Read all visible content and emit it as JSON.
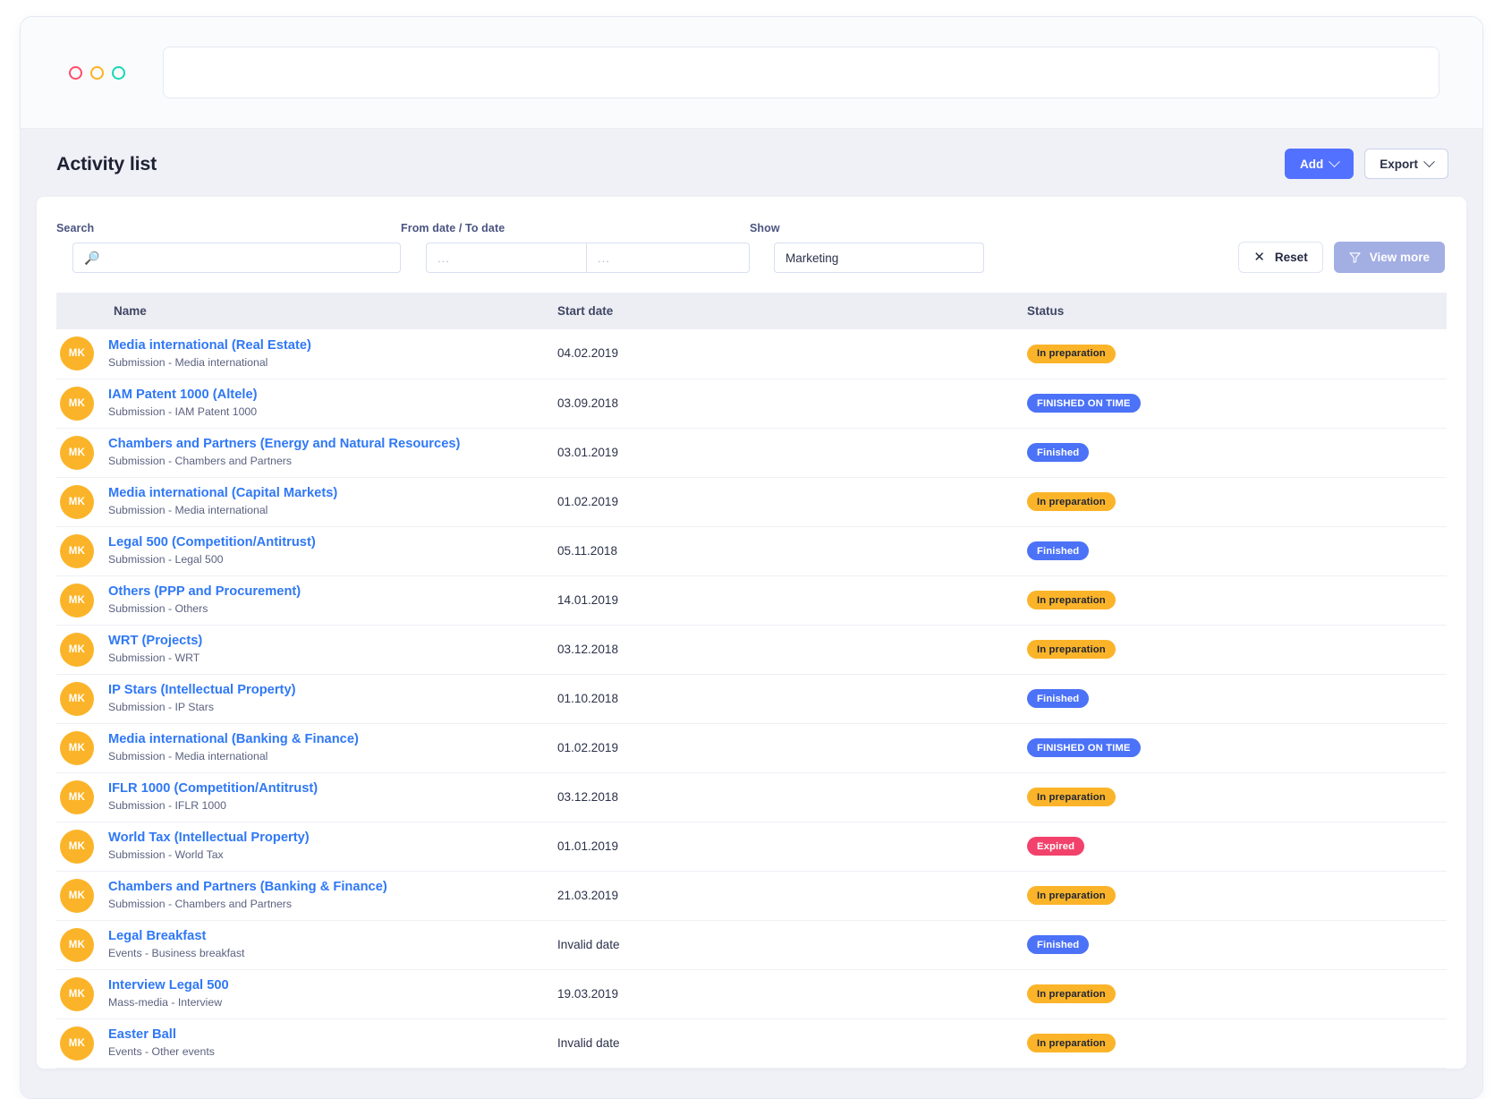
{
  "window": {
    "traffic_lights": [
      "red",
      "yellow",
      "green"
    ],
    "url_value": ""
  },
  "header": {
    "title": "Activity list",
    "add_label": "Add",
    "export_label": "Export"
  },
  "filters": {
    "search": {
      "label": "Search",
      "value": "",
      "placeholder": ""
    },
    "dates": {
      "label": "From date / To date",
      "from_value": "...",
      "to_value": "..."
    },
    "show": {
      "label": "Show",
      "value": "Marketing"
    },
    "reset_label": "Reset",
    "view_more_label": "View more"
  },
  "table": {
    "columns": {
      "name": "Name",
      "start_date": "Start date",
      "status": "Status"
    },
    "rows": [
      {
        "initials": "MK",
        "name": "Media international (Real Estate)",
        "sub": "Submission - Media international",
        "date": "04.02.2019",
        "status": "In preparation",
        "status_kind": "warning"
      },
      {
        "initials": "MK",
        "name": "IAM Patent 1000 (Altele)",
        "sub": "Submission - IAM Patent 1000",
        "date": "03.09.2018",
        "status": "FINISHED ON TIME",
        "status_kind": "primary"
      },
      {
        "initials": "MK",
        "name": "Chambers and Partners (Energy and Natural Resources)",
        "sub": "Submission - Chambers and Partners",
        "date": "03.01.2019",
        "status": "Finished",
        "status_kind": "primary"
      },
      {
        "initials": "MK",
        "name": "Media international (Capital Markets)",
        "sub": "Submission - Media international",
        "date": "01.02.2019",
        "status": "In preparation",
        "status_kind": "warning"
      },
      {
        "initials": "MK",
        "name": "Legal 500 (Competition/Antitrust)",
        "sub": "Submission - Legal 500",
        "date": "05.11.2018",
        "status": "Finished",
        "status_kind": "primary"
      },
      {
        "initials": "MK",
        "name": "Others (PPP and Procurement)",
        "sub": "Submission - Others",
        "date": "14.01.2019",
        "status": "In preparation",
        "status_kind": "warning"
      },
      {
        "initials": "MK",
        "name": "WRT (Projects)",
        "sub": "Submission - WRT",
        "date": "03.12.2018",
        "status": "In preparation",
        "status_kind": "warning"
      },
      {
        "initials": "MK",
        "name": "IP Stars (Intellectual Property)",
        "sub": "Submission - IP Stars",
        "date": "01.10.2018",
        "status": "Finished",
        "status_kind": "primary"
      },
      {
        "initials": "MK",
        "name": "Media international (Banking & Finance)",
        "sub": "Submission - Media international",
        "date": "01.02.2019",
        "status": "FINISHED ON TIME",
        "status_kind": "primary"
      },
      {
        "initials": "MK",
        "name": "IFLR 1000 (Competition/Antitrust)",
        "sub": "Submission - IFLR 1000",
        "date": "03.12.2018",
        "status": "In preparation",
        "status_kind": "warning"
      },
      {
        "initials": "MK",
        "name": "World Tax (Intellectual Property)",
        "sub": "Submission - World Tax",
        "date": "01.01.2019",
        "status": "Expired",
        "status_kind": "danger"
      },
      {
        "initials": "MK",
        "name": "Chambers and Partners (Banking & Finance)",
        "sub": "Submission - Chambers and Partners",
        "date": "21.03.2019",
        "status": "In preparation",
        "status_kind": "warning"
      },
      {
        "initials": "MK",
        "name": "Legal Breakfast",
        "sub": "Events - Business breakfast",
        "date": "Invalid date",
        "status": "Finished",
        "status_kind": "primary"
      },
      {
        "initials": "MK",
        "name": "Interview Legal 500",
        "sub": "Mass-media - Interview",
        "date": "19.03.2019",
        "status": "In preparation",
        "status_kind": "warning"
      },
      {
        "initials": "MK",
        "name": "Easter Ball",
        "sub": "Events - Other events",
        "date": "Invalid date",
        "status": "In preparation",
        "status_kind": "warning"
      }
    ]
  },
  "colors": {
    "accent_blue": "#5271ff",
    "link_blue": "#2f78f6",
    "avatar_orange": "#fbb429",
    "badge_warning": "#fbb429",
    "badge_primary": "#4b72f7",
    "badge_danger": "#f2426b",
    "view_more_muted": "#a3aee3",
    "page_bg": "#f0f1f6"
  }
}
